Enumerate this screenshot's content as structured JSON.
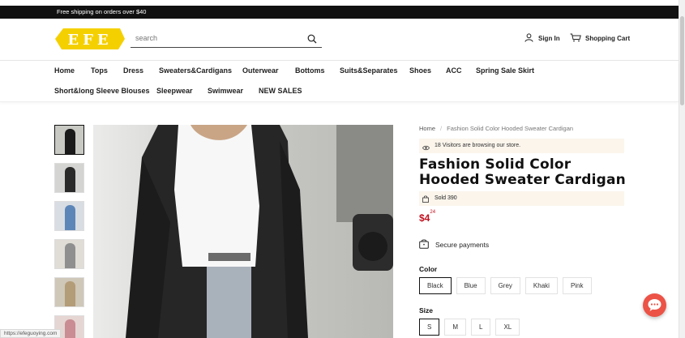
{
  "topbar": {
    "promo": "Free shipping on orders over $40"
  },
  "header": {
    "logo_text": "EFE",
    "search_placeholder": "search",
    "sign_in": "Sign In",
    "cart": "Shopping Cart"
  },
  "nav": {
    "row1": [
      "Home",
      "Tops",
      "Dress",
      "Sweaters&Cardigans",
      "Outerwear",
      "Bottoms",
      "Suits&Separates",
      "Shoes",
      "ACC",
      "Spring Sale Skirt"
    ],
    "row2": [
      "Short&long Sleeve Blouses",
      "Sleepwear",
      "Swimwear",
      "NEW SALES"
    ]
  },
  "product": {
    "breadcrumb_home": "Home",
    "breadcrumb_sep": "/",
    "breadcrumb_current": "Fashion Solid Color Hooded Sweater Cardigan",
    "visitors": "18 Visitors are browsing our store.",
    "title": "Fashion Solid Color Hooded Sweater Cardigan",
    "sold": "Sold 390",
    "price_main": "$4",
    "price_cents": "24",
    "secure": "Secure payments",
    "color_label": "Color",
    "colors": [
      "Black",
      "Blue",
      "Grey",
      "Khaki",
      "Pink"
    ],
    "selected_color": "Black",
    "size_label": "Size",
    "sizes": [
      "S",
      "M",
      "L",
      "XL"
    ],
    "selected_size": "S"
  },
  "status_url": "https://efeguoying.com",
  "colors": {
    "accent_red": "#c0111f",
    "logo_yellow": "#f5d000",
    "chat_red": "#ec5246",
    "note_bg": "#fbf5ec"
  }
}
